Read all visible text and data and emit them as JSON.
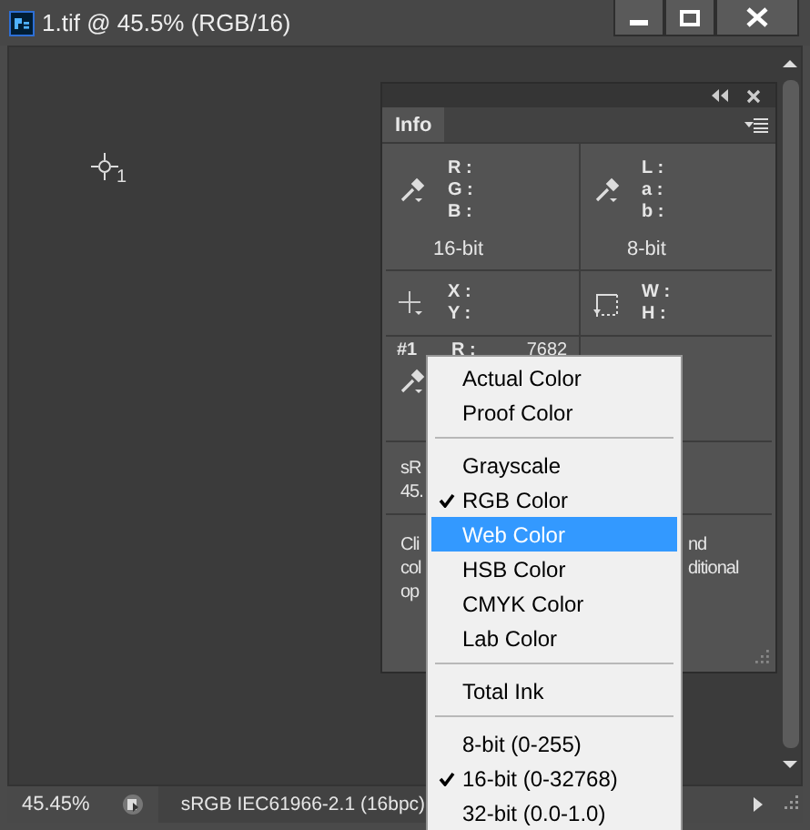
{
  "window": {
    "title": "1.tif @ 45.5% (RGB/16)"
  },
  "canvas": {
    "sampler_label": "1"
  },
  "info_panel": {
    "tabs": [
      {
        "label": "Info",
        "selected": true
      }
    ],
    "readouts": [
      {
        "kind": "color",
        "labels": [
          "R :",
          "G :",
          "B :"
        ],
        "mode": "16-bit"
      },
      {
        "kind": "color",
        "labels": [
          "L :",
          "a :",
          "b :"
        ],
        "mode": "8-bit"
      },
      {
        "kind": "position",
        "labels": [
          "X :",
          "Y :"
        ]
      },
      {
        "kind": "size",
        "labels": [
          "W :",
          "H :"
        ]
      }
    ],
    "sampler": {
      "label": "#1",
      "rows": [
        {
          "label": "R :",
          "value": "7682"
        }
      ]
    },
    "doc_info_fragment": [
      "sR",
      "45."
    ],
    "hint_fragment_left": [
      "Cli",
      "col",
      "op"
    ],
    "hint_fragment_right": [
      "nd",
      "ditional"
    ]
  },
  "context_menu": {
    "items": [
      {
        "kind": "item",
        "label": "Actual Color",
        "checked": false,
        "selected": false
      },
      {
        "kind": "item",
        "label": "Proof Color",
        "checked": false,
        "selected": false
      },
      {
        "kind": "separator"
      },
      {
        "kind": "item",
        "label": "Grayscale",
        "checked": false,
        "selected": false
      },
      {
        "kind": "item",
        "label": "RGB Color",
        "checked": true,
        "selected": false
      },
      {
        "kind": "item",
        "label": "Web Color",
        "checked": false,
        "selected": true
      },
      {
        "kind": "item",
        "label": "HSB Color",
        "checked": false,
        "selected": false
      },
      {
        "kind": "item",
        "label": "CMYK Color",
        "checked": false,
        "selected": false
      },
      {
        "kind": "item",
        "label": "Lab Color",
        "checked": false,
        "selected": false
      },
      {
        "kind": "separator"
      },
      {
        "kind": "item",
        "label": "Total Ink",
        "checked": false,
        "selected": false
      },
      {
        "kind": "separator"
      },
      {
        "kind": "item",
        "label": "8-bit (0-255)",
        "checked": false,
        "selected": false
      },
      {
        "kind": "item",
        "label": "16-bit (0-32768)",
        "checked": true,
        "selected": false
      },
      {
        "kind": "item",
        "label": "32-bit (0.0-1.0)",
        "checked": false,
        "selected": false
      }
    ]
  },
  "status_bar": {
    "zoom": "45.45%",
    "profile": "sRGB IEC61966-2.1 (16bpc)"
  }
}
